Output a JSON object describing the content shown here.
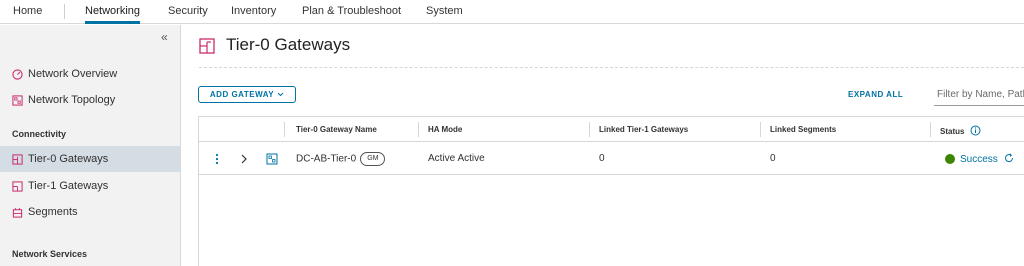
{
  "topnav": {
    "tabs": [
      {
        "label": "Home"
      },
      {
        "label": "Networking"
      },
      {
        "label": "Security"
      },
      {
        "label": "Inventory"
      },
      {
        "label": "Plan & Troubleshoot"
      },
      {
        "label": "System"
      }
    ],
    "active_tab": "Networking"
  },
  "sidebar": {
    "collapse_glyph": "«",
    "items": [
      {
        "label": "Network Overview",
        "icon": "gauge-icon"
      },
      {
        "label": "Network Topology",
        "icon": "topology-icon"
      },
      {
        "label": "Tier-0 Gateways",
        "icon": "tier0-gateway-icon"
      },
      {
        "label": "Tier-1 Gateways",
        "icon": "tier1-gateway-icon"
      },
      {
        "label": "Segments",
        "icon": "segments-icon"
      }
    ],
    "sections": {
      "connectivity": "Connectivity",
      "network_services": "Network Services"
    },
    "active_item": "Tier-0 Gateways"
  },
  "main": {
    "title": "Tier-0 Gateways",
    "add_button": "ADD GATEWAY",
    "expand_all": "EXPAND ALL",
    "filter_placeholder": "Filter by Name, Path and more",
    "columns": [
      "Tier-0 Gateway Name",
      "HA Mode",
      "Linked Tier-1 Gateways",
      "Linked Segments",
      "Status"
    ],
    "rows": [
      {
        "name": "DC-AB-Tier-0",
        "badge": "GM",
        "ha_mode": "Active Active",
        "linked_tier1": "0",
        "linked_segments": "0",
        "status": "Success"
      }
    ]
  },
  "colors": {
    "accent": "#0072a3",
    "success": "#3c8500",
    "icon_pink": "#c92c6d"
  }
}
